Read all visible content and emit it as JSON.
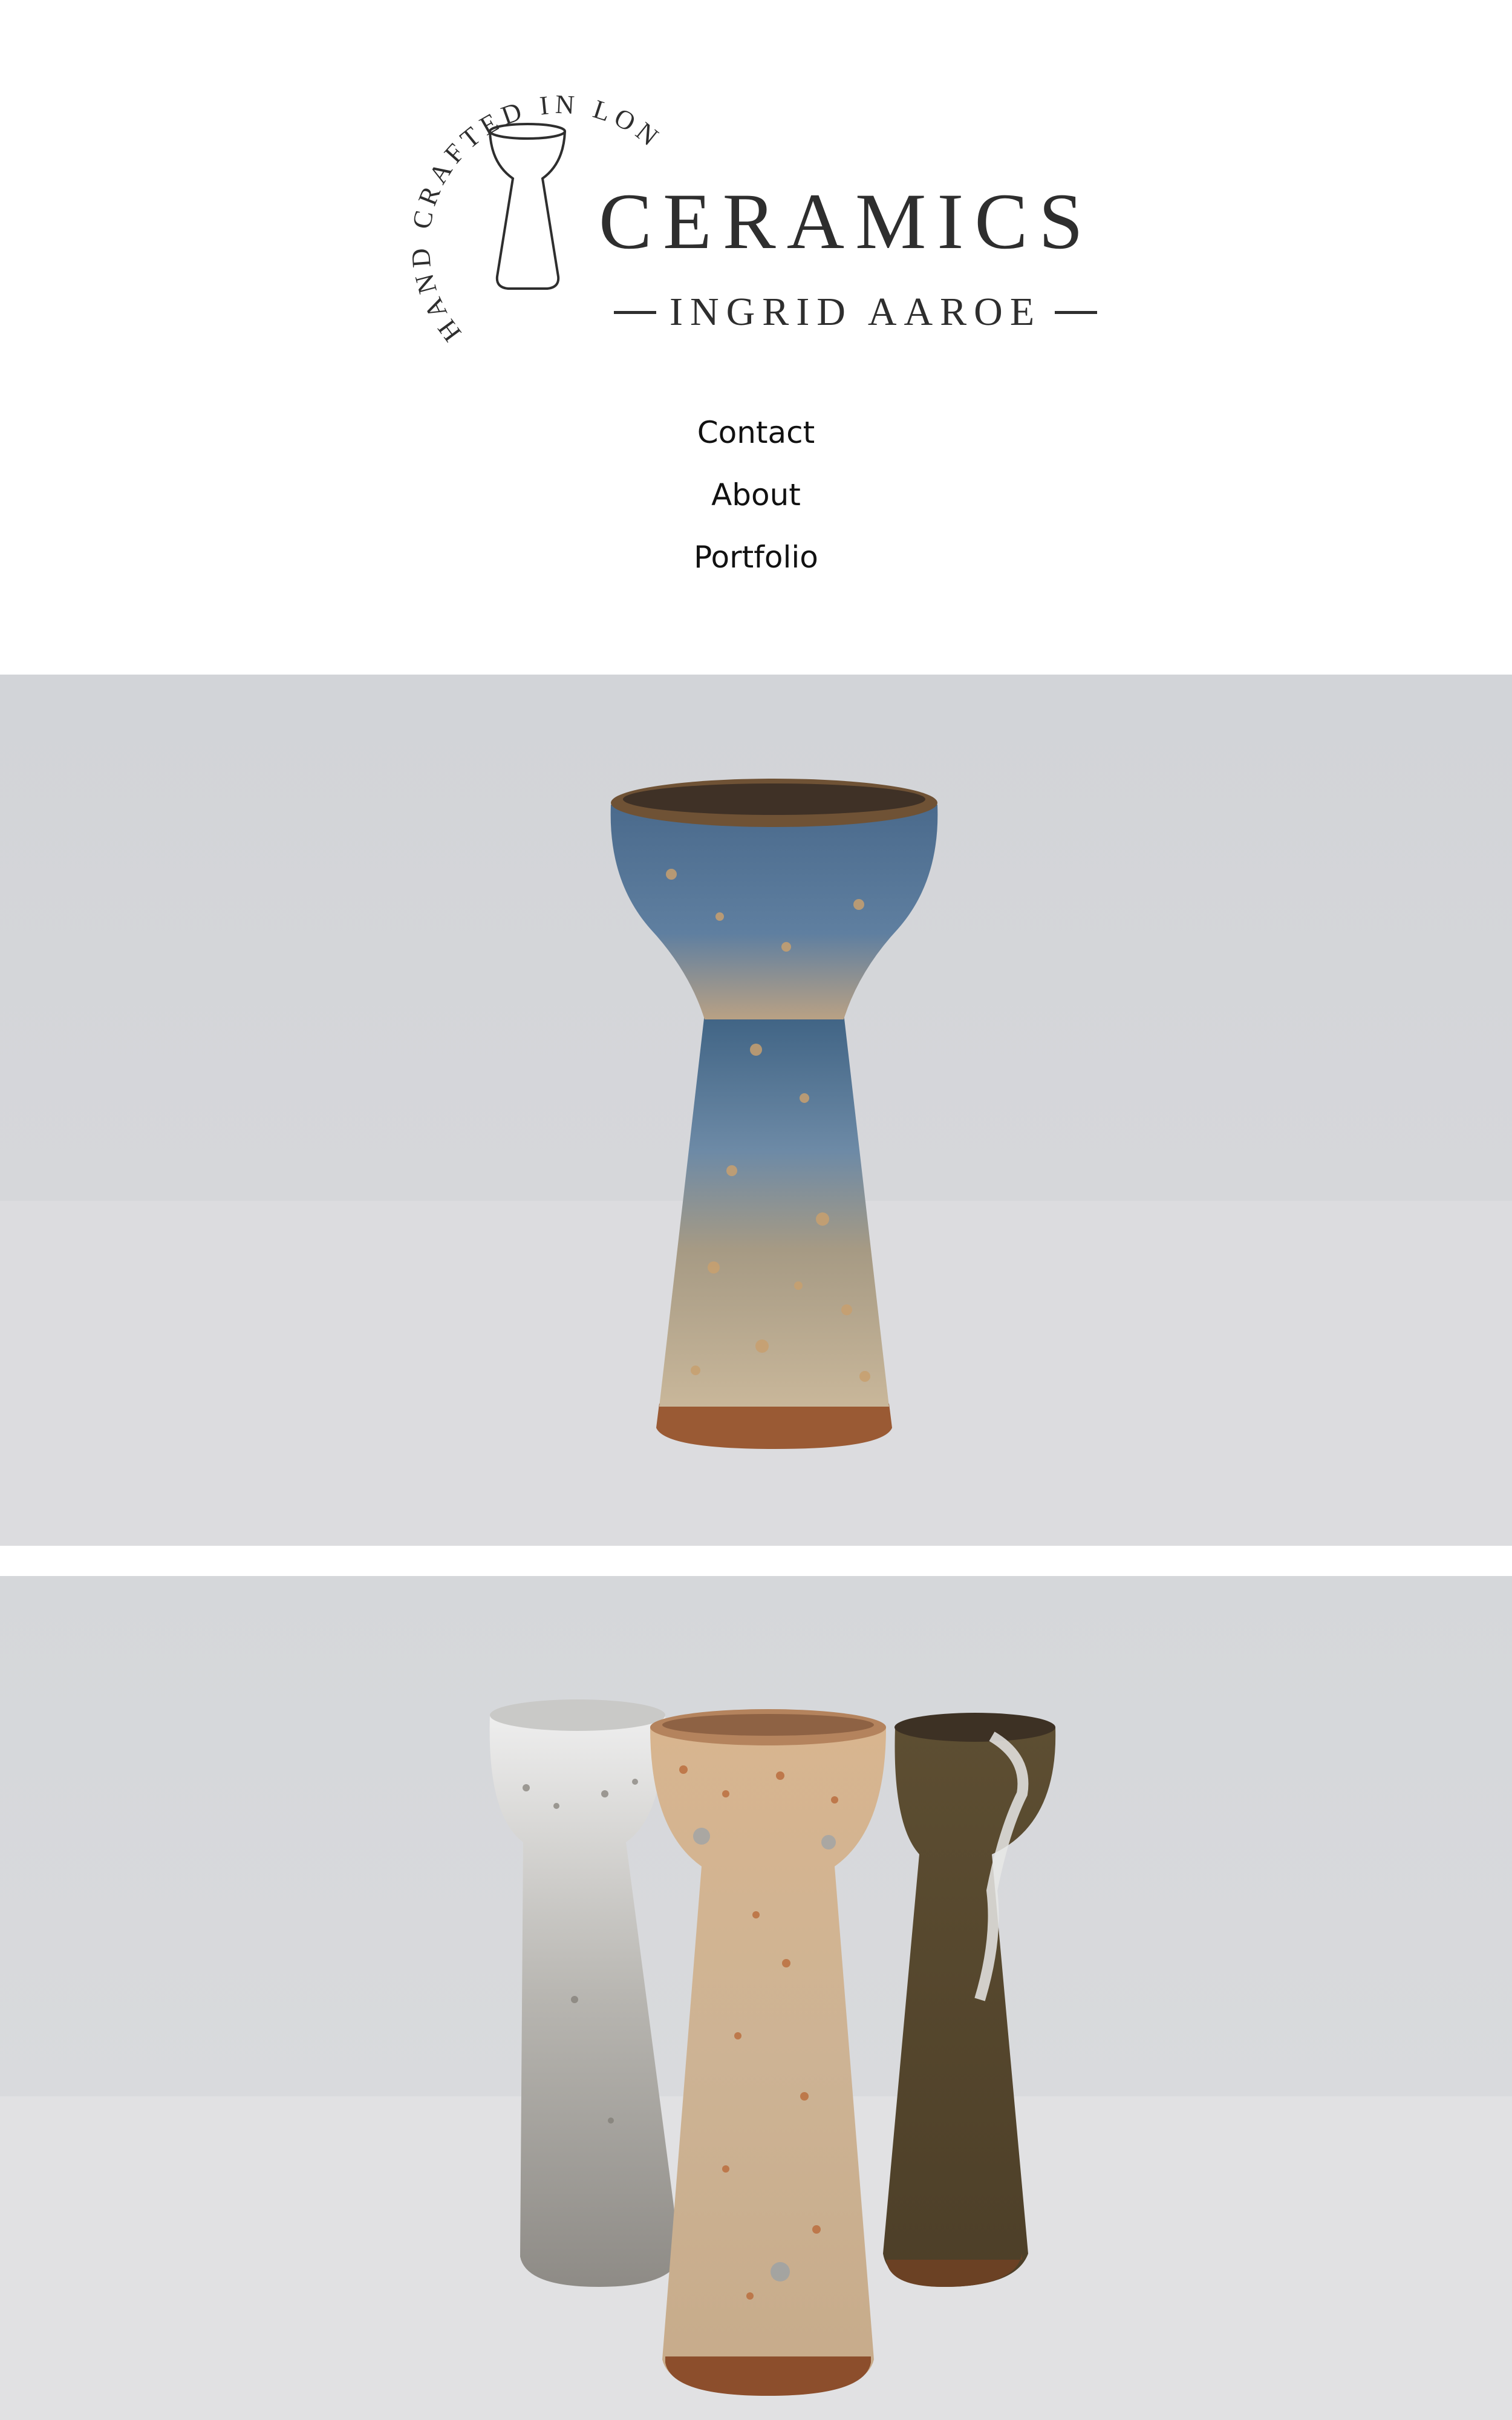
{
  "logo": {
    "arc_text": "HAND CRAFTED IN LONDON",
    "title": "CERAMICS",
    "subtitle": "INGRID AAROE"
  },
  "nav": {
    "items": [
      {
        "label": "Contact"
      },
      {
        "label": "About"
      },
      {
        "label": "Portfolio"
      }
    ]
  },
  "photos": [
    {
      "subject": "blue-glazed-candle-holder"
    },
    {
      "subject": "three-candle-holders"
    }
  ],
  "colors": {
    "background": "#ffffff",
    "text": "#111111",
    "logo": "#2e2e2e",
    "backdrop": "#d8d9dd"
  }
}
